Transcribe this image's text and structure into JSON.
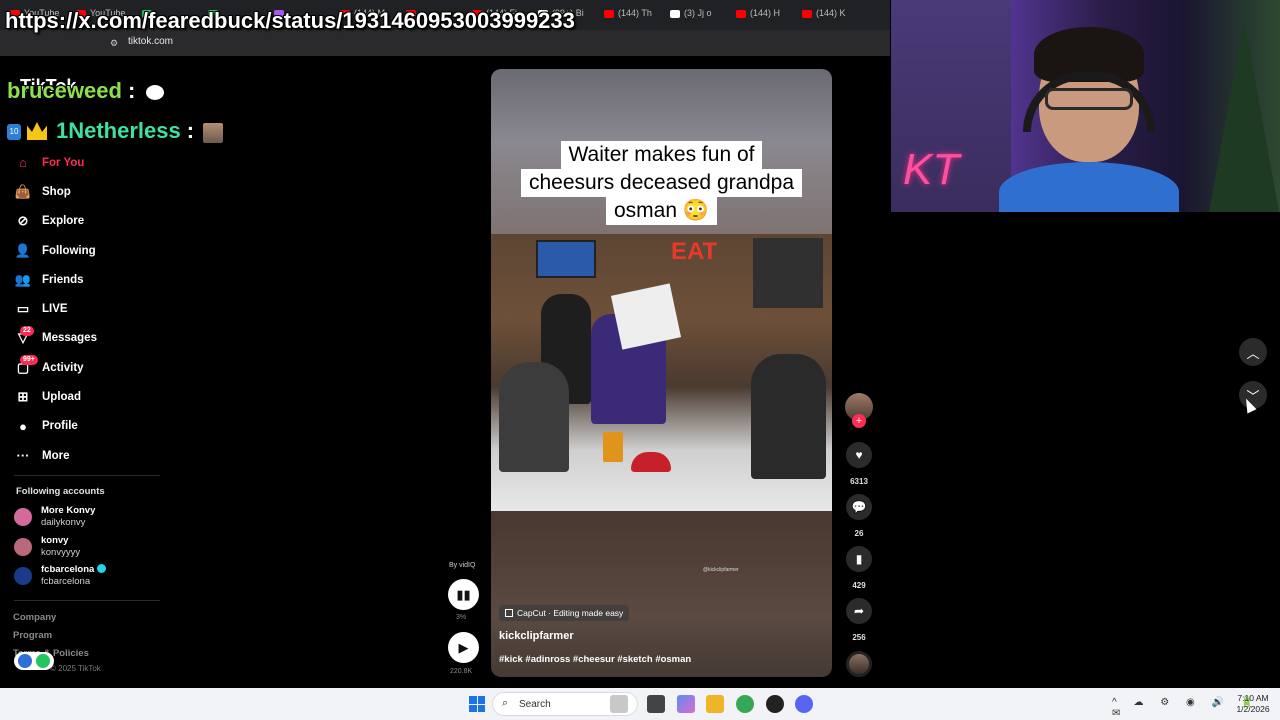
{
  "browser": {
    "tabs": [
      {
        "label": "YouTube",
        "color": "#ff0000"
      },
      {
        "label": "YouTube",
        "color": "#ff0000"
      },
      {
        "label": "",
        "color": "#22c55e"
      },
      {
        "label": "",
        "color": "#22c55e"
      },
      {
        "label": "",
        "color": "#a855f7"
      },
      {
        "label": "(144) M",
        "color": "#ff0000"
      },
      {
        "label": "",
        "color": "#ff0000"
      },
      {
        "label": "(144) Fi",
        "color": "#ff0000"
      },
      {
        "label": "(99+) Bi",
        "color": "#ffffff"
      },
      {
        "label": "(144) Th",
        "color": "#ff0000"
      },
      {
        "label": "(3) Jj o",
        "color": "#ffffff"
      },
      {
        "label": "(144) H",
        "color": "#ff0000"
      },
      {
        "label": "(144) K",
        "color": "#ff0000"
      }
    ],
    "url": "tiktok.com"
  },
  "overlay": {
    "stream_url": "https://x.com/fearedbuck/status/1931460953003999233",
    "chat": [
      {
        "user": "bruceweed",
        "sep": ":"
      },
      {
        "user": "1Netherless",
        "sep": ":",
        "badge": "10"
      }
    ]
  },
  "tiktok": {
    "logo": "TikTok",
    "nav": [
      {
        "label": "For You",
        "icon": "home-icon",
        "glyph": "⌂",
        "active": true
      },
      {
        "label": "Shop",
        "icon": "shopping-bag-icon",
        "glyph": "👜"
      },
      {
        "label": "Explore",
        "icon": "compass-icon",
        "glyph": "⊘"
      },
      {
        "label": "Following",
        "icon": "person-check-icon",
        "glyph": "👤"
      },
      {
        "label": "Friends",
        "icon": "friends-icon",
        "glyph": "👥"
      },
      {
        "label": "LIVE",
        "icon": "live-icon",
        "glyph": "▭"
      },
      {
        "label": "Messages",
        "icon": "paper-plane-icon",
        "glyph": "▽",
        "badge": "22"
      },
      {
        "label": "Activity",
        "icon": "activity-icon",
        "glyph": "▢",
        "badge": "99+"
      },
      {
        "label": "Upload",
        "icon": "plus-square-icon",
        "glyph": "⊞"
      },
      {
        "label": "Profile",
        "icon": "avatar-icon",
        "glyph": "●"
      },
      {
        "label": "More",
        "icon": "ellipsis-icon",
        "glyph": "···"
      }
    ],
    "following_title": "Following accounts",
    "following": [
      {
        "name": "More Konvy",
        "handle": "dailykonvy",
        "color": "#d46a9a"
      },
      {
        "name": "konvy",
        "handle": "konvyyyy",
        "color": "#b86a7a"
      },
      {
        "name": "fcbarcelona",
        "handle": "fcbarcelona",
        "color": "#1a3a8a",
        "verified": true
      }
    ],
    "footer": [
      "Company",
      "Program",
      "Terms & Policies"
    ],
    "copyright": "© 2025 TikTok",
    "video": {
      "caption": [
        "Waiter makes fun of",
        "cheesurs deceased grandpa",
        "osman 😳"
      ],
      "sign": "EAT",
      "watermark": "@kickclipfarmer",
      "capcut": "CapCut · Editing made easy",
      "author": "kickclipfarmer",
      "tags": "#kick #adinross #cheesur #sketch #osman"
    },
    "actions": [
      {
        "icon": "heart-icon",
        "glyph": "♥",
        "count": "6313"
      },
      {
        "icon": "comment-icon",
        "glyph": "💬",
        "count": "26"
      },
      {
        "icon": "bookmark-icon",
        "glyph": "▮",
        "count": "429"
      },
      {
        "icon": "share-icon",
        "glyph": "➦",
        "count": "256"
      }
    ],
    "vidiq": {
      "label": "By vidIQ",
      "pct": "3%",
      "views": "220.8K"
    }
  },
  "taskbar": {
    "search": "Search",
    "time": "7:10 AM",
    "date": "1/2/2026"
  }
}
